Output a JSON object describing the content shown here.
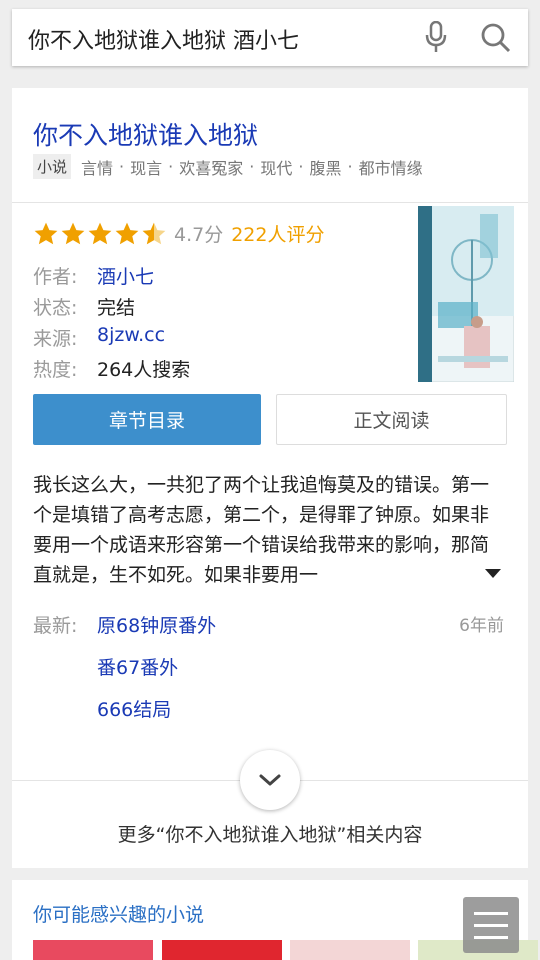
{
  "search": {
    "query": "你不入地狱谁入地狱 酒小七"
  },
  "book": {
    "title": "你不入地狱谁入地狱",
    "tag_badge": "小说",
    "tags": [
      "言情",
      "现言",
      "欢喜冤家",
      "现代",
      "腹黑",
      "都市情缘"
    ],
    "rating": {
      "stars": 4.5,
      "score": "4.7分",
      "reviews": "222人评分"
    },
    "info": [
      {
        "key": "作者:",
        "value": "酒小七"
      },
      {
        "key": "状态:",
        "value": "完结"
      },
      {
        "key": "来源:",
        "value": "8jzw.cc"
      },
      {
        "key": "热度:",
        "value": "264人搜索"
      }
    ],
    "buttons": {
      "toc": "章节目录",
      "read": "正文阅读"
    },
    "summary": "我长这么大，一共犯了两个让我追悔莫及的错误。第一个是填错了高考志愿，第二个，是得罪了钟原。如果非要用一个成语来形容第一个错误给我带来的影响，那简直就是，生不如死。如果非要用一",
    "latest": {
      "label": "最新:",
      "time": "6年前",
      "chapters": [
        "原68钟原番外",
        "番67番外",
        "666结局"
      ]
    },
    "more_related": "更多“你不入地狱谁入地狱”相关内容"
  },
  "recommend": {
    "title": "你可能感兴趣的小说"
  },
  "colors": {
    "accent": "#3d8fcc",
    "link": "#1a3ab5",
    "star": "#f0a000"
  },
  "icons": [
    "mic-icon",
    "search-icon",
    "star-icon",
    "expand-icon",
    "chevron-down-icon",
    "menu-icon"
  ]
}
